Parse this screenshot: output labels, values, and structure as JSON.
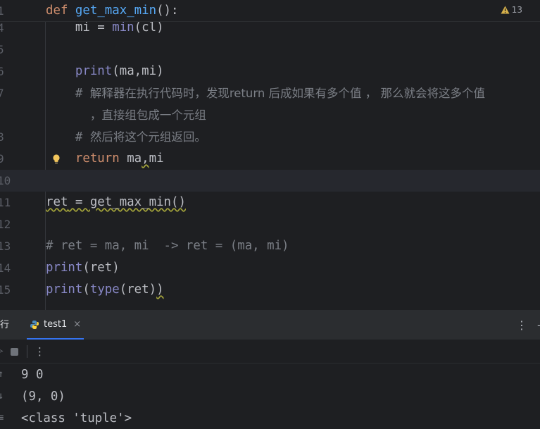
{
  "editor": {
    "warnings_count": "13",
    "sticky": {
      "num": "1",
      "tokens": [
        {
          "t": "def",
          "c": "kw"
        },
        {
          "t": " "
        },
        {
          "t": "get_max_min",
          "c": "fn"
        },
        {
          "t": "():"
        }
      ]
    },
    "lines": [
      {
        "num": "4",
        "tokens": [
          {
            "t": "    mi = "
          },
          {
            "t": "min",
            "c": "bi"
          },
          {
            "t": "(cl)"
          }
        ]
      },
      {
        "num": "5",
        "tokens": []
      },
      {
        "num": "6",
        "tokens": [
          {
            "t": "    "
          },
          {
            "t": "print",
            "c": "bi"
          },
          {
            "t": "(ma,mi)"
          }
        ]
      },
      {
        "num": "7",
        "tokens": [
          {
            "t": "    # ",
            "c": "cm"
          },
          {
            "t": "解释器在执行代码时，发现return 后成如果有多个值 ， 那么就会将这多个值",
            "c": "cmcn"
          }
        ]
      },
      {
        "num": "",
        "tokens": [
          {
            "t": "      ",
            "c": "cm"
          },
          {
            "t": "，直接组包成一个元组",
            "c": "cmcn"
          }
        ]
      },
      {
        "num": "8",
        "tokens": [
          {
            "t": "    # ",
            "c": "cm"
          },
          {
            "t": "然后将这个元组返回。",
            "c": "cmcn"
          }
        ]
      },
      {
        "num": "9",
        "bulb": true,
        "tokens": [
          {
            "t": "    "
          },
          {
            "t": "return",
            "c": "kw"
          },
          {
            "t": " ma"
          },
          {
            "t": ",",
            "c": "squig"
          },
          {
            "t": "mi"
          }
        ]
      },
      {
        "num": "10",
        "current": true,
        "tokens": []
      },
      {
        "num": "11",
        "tokens": [
          {
            "t": "ret",
            "c": "squig"
          },
          {
            "t": " = get_max_min()",
            "c": "squig"
          }
        ]
      },
      {
        "num": "12",
        "tokens": []
      },
      {
        "num": "13",
        "tokens": [
          {
            "t": "# ret = ma, mi  -> ret = (ma, mi)",
            "c": "cm"
          }
        ]
      },
      {
        "num": "14",
        "tokens": [
          {
            "t": "print",
            "c": "bi"
          },
          {
            "t": "(ret)"
          }
        ]
      },
      {
        "num": "15",
        "tokens": [
          {
            "t": "print",
            "c": "bi"
          },
          {
            "t": "("
          },
          {
            "t": "type",
            "c": "bi"
          },
          {
            "t": "(ret)"
          },
          {
            "t": ")",
            "c": "squig"
          }
        ]
      }
    ]
  },
  "run_panel": {
    "label": "行",
    "tab": {
      "name": "test1",
      "close": "×"
    },
    "menu_glyph": "⋮",
    "toolbar_more": "⋮",
    "output": [
      "9 0",
      "(9, 0)",
      "<class 'tuple'>"
    ]
  },
  "icons": [
    "warning-icon",
    "lightbulb-icon",
    "python-icon",
    "close-icon",
    "more-icon",
    "stop-icon"
  ],
  "colors": {
    "background": "#1e1f22",
    "keyword": "#cf8e6d",
    "function": "#56a8f5",
    "builtin": "#8888c6",
    "comment": "#7a7e85",
    "text": "#bcbec4",
    "tab_underline": "#3574f0"
  }
}
